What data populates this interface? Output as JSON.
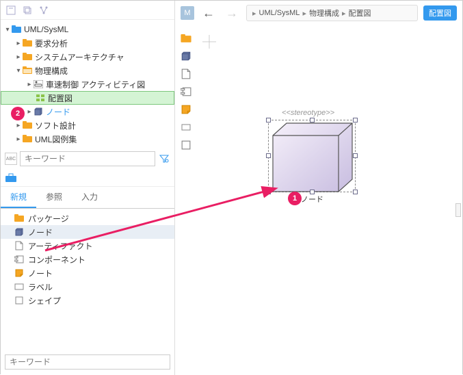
{
  "toolbar": {
    "collapse_tooltip": "collapse",
    "copy_tooltip": "copy",
    "structure_tooltip": "structure"
  },
  "tree": {
    "root": "UML/SysML",
    "items": [
      {
        "label": "要求分析",
        "type": "folder",
        "indent": 1
      },
      {
        "label": "システムアーキテクチャ",
        "type": "folder",
        "indent": 1
      },
      {
        "label": "物理構成",
        "type": "folder-open",
        "indent": 1
      },
      {
        "label": "車速制御 アクティビティ図",
        "type": "activity",
        "indent": 2
      },
      {
        "label": "配置図",
        "type": "deployment",
        "indent": 2,
        "selected": true
      },
      {
        "label": "ノード",
        "type": "node",
        "indent": 2,
        "link": true
      },
      {
        "label": "ソフト設計",
        "type": "folder",
        "indent": 1
      },
      {
        "label": "UML図例集",
        "type": "folder",
        "indent": 1
      }
    ]
  },
  "search": {
    "placeholder": "キーワード",
    "abc_label": "ABC"
  },
  "tabs": {
    "items": [
      "新規",
      "参照",
      "入力"
    ],
    "active": 0
  },
  "palette_list": {
    "items": [
      {
        "label": "パッケージ",
        "icon": "folder-yellow"
      },
      {
        "label": "ノード",
        "icon": "cuboid",
        "highlighted": true
      },
      {
        "label": "アーティファクト",
        "icon": "document"
      },
      {
        "label": "コンポーネント",
        "icon": "component"
      },
      {
        "label": "ノート",
        "icon": "note"
      },
      {
        "label": "ラベル",
        "icon": "label"
      },
      {
        "label": "シェイプ",
        "icon": "shape"
      }
    ]
  },
  "bottom_search": {
    "placeholder": "キーワード"
  },
  "header": {
    "badge": "M",
    "breadcrumb": [
      "UML/SysML",
      "物理構成",
      "配置図"
    ],
    "tag": "配置図"
  },
  "canvas": {
    "stereotype": "<<stereotype>>",
    "node_label": "ノード"
  },
  "callouts": {
    "badge1": "1",
    "badge2": "2"
  }
}
